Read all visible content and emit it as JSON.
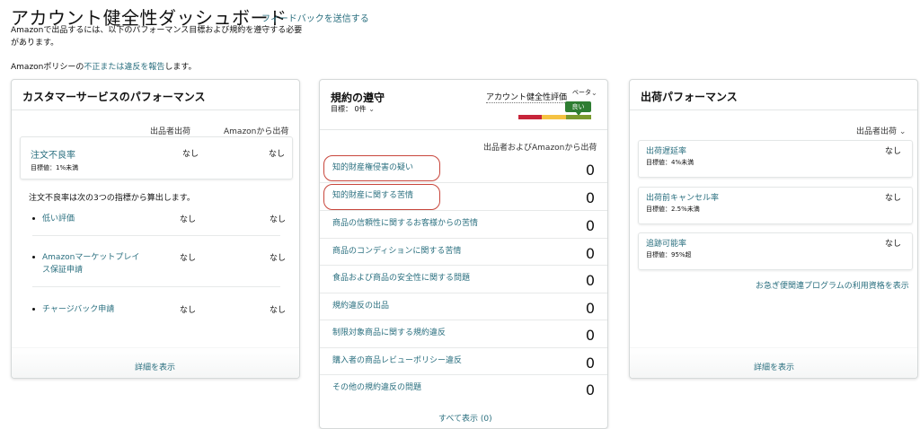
{
  "header": {
    "title": "アカウント健全性ダッシュボード",
    "feedback_link": "フィードバックを送信する",
    "intro": "Amazonで出品するには、以下のパフォーマンス目標および規約を遵守する必要があります。",
    "policy_prefix": "Amazonポリシーの",
    "policy_link": "不正または違反を報告",
    "policy_suffix": "します。"
  },
  "customer_service": {
    "title": "カスタマーサービスのパフォーマンス",
    "col_seller": "出品者出荷",
    "col_amazon": "Amazonから出荷",
    "odr": {
      "label": "注文不良率",
      "target": "目標値：1%未満",
      "seller": "なし",
      "amazon": "なし"
    },
    "note": "注文不良率は次の3つの指標から算出します。",
    "metrics": [
      {
        "label": "低い評価",
        "seller": "なし",
        "amazon": "なし"
      },
      {
        "label": "Amazonマーケットプレイス保証申請",
        "seller": "なし",
        "amazon": "なし"
      },
      {
        "label": "チャージバック申請",
        "seller": "なし",
        "amazon": "なし"
      }
    ],
    "details_link": "詳細を表示"
  },
  "compliance": {
    "title": "規約の遵守",
    "target": "目標： 0件",
    "target_chevron": "⌄",
    "rating_label": "アカウント健全性評価",
    "beta": "ベータ",
    "rating_chevron": "⌄",
    "rating_badge": "良い",
    "bar_colors": [
      "#c7243a",
      "#f5c242",
      "#7a9a2e"
    ],
    "col_header": "出品者およびAmazonから出荷",
    "rows": [
      {
        "label": "知的財産権侵害の疑い",
        "count": "0"
      },
      {
        "label": "知的財産に関する苦情",
        "count": "0"
      },
      {
        "label": "商品の信頼性に関するお客様からの苦情",
        "count": "0"
      },
      {
        "label": "商品のコンディションに関する苦情",
        "count": "0"
      },
      {
        "label": "食品および商品の安全性に関する問題",
        "count": "0"
      },
      {
        "label": "規約違反の出品",
        "count": "0"
      },
      {
        "label": "制限対象商品に関する規約違反",
        "count": "0"
      },
      {
        "label": "購入者の商品レビューポリシー違反",
        "count": "0"
      },
      {
        "label": "その他の規約違反の問題",
        "count": "0"
      }
    ],
    "view_all": "すべて表示 (0)"
  },
  "shipping": {
    "title": "出荷パフォーマンス",
    "selector": "出品者出荷",
    "selector_chevron": "⌄",
    "metrics": [
      {
        "label": "出荷遅延率",
        "target": "目標値：4%未満",
        "value": "なし"
      },
      {
        "label": "出荷前キャンセル率",
        "target": "目標値：2.5%未満",
        "value": "なし"
      },
      {
        "label": "追跡可能率",
        "target": "目標値：95%超",
        "value": "なし"
      }
    ],
    "program_link": "お急ぎ便関連プログラムの利用資格を表示",
    "details_link": "詳細を表示"
  },
  "colors": {
    "link": "#2a6f7f",
    "highlight": "#c8463c",
    "badge": "#2e7d32"
  }
}
